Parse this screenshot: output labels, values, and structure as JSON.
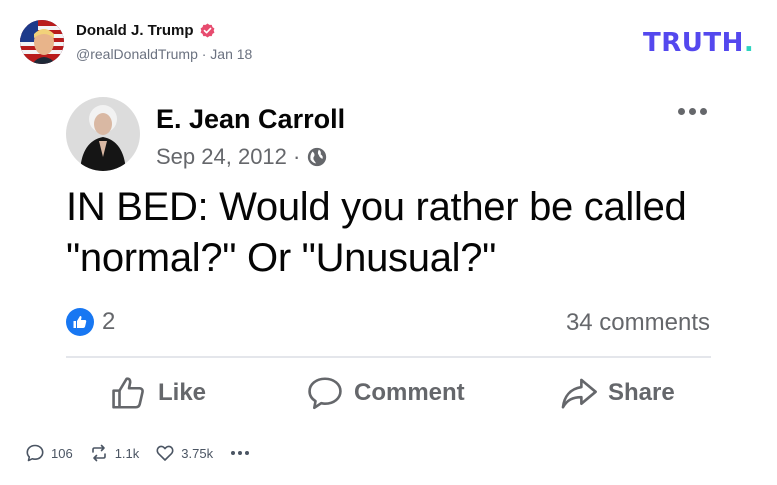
{
  "post": {
    "author_name": "Donald J. Trump",
    "handle_line": "@realDonaldTrump · Jan 18",
    "verified_icon": "verified-badge-icon",
    "brand": "TRUTH",
    "brand_dot": ".",
    "brand_color": "#5448ee",
    "brand_dot_color": "#2dd4bf"
  },
  "embedded": {
    "author_name": "E. Jean Carroll",
    "date": "Sep 24, 2012 ·",
    "privacy_icon": "globe-icon",
    "text_line1": "IN BED: Would you rather be called",
    "text_line2": "\"normal?\" Or \"Unusual?\"",
    "reaction_count": "2",
    "comments": "34 comments",
    "actions": {
      "like": "Like",
      "comment": "Comment",
      "share": "Share"
    },
    "accent_color": "#1877f2"
  },
  "engagement": {
    "replies": "106",
    "retruths": "1.1k",
    "likes": "3.75k"
  }
}
